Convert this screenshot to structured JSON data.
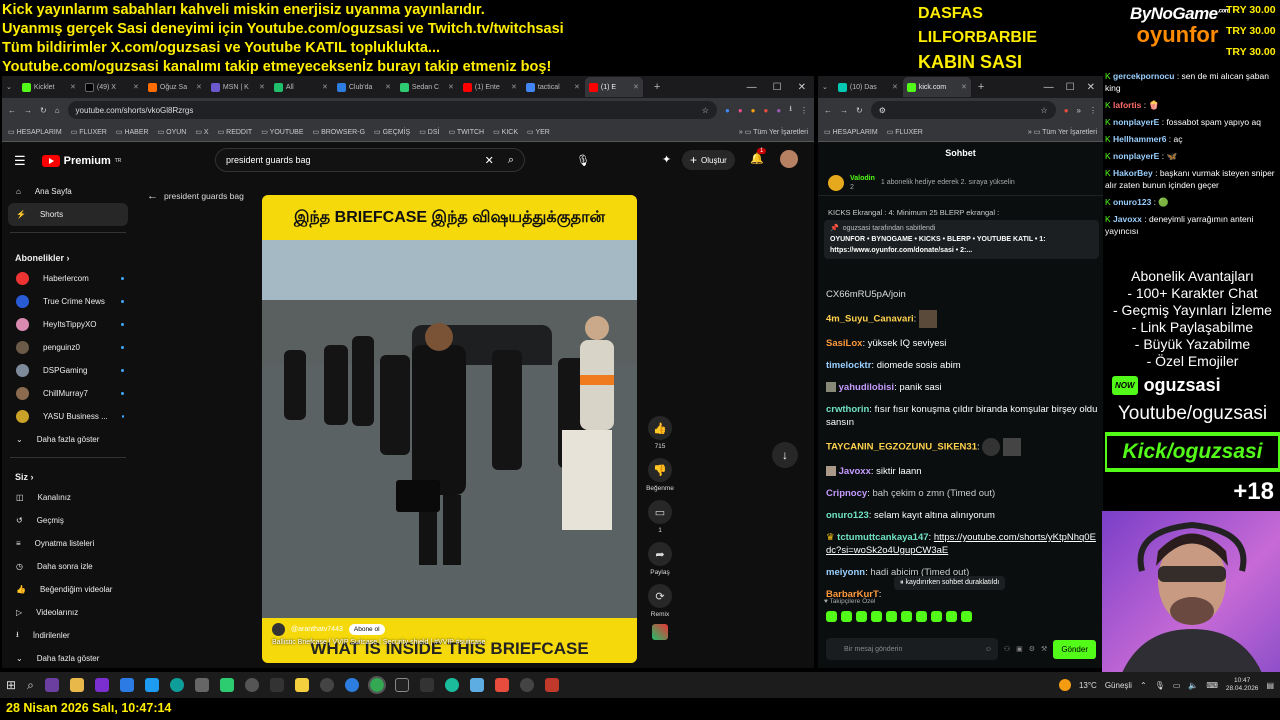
{
  "overlay": {
    "lines": [
      "Kick yayınlarım sabahları kahveli miskin enerjisiz uyanma yayınlarıdır.",
      "Uyanmış gerçek Sasi deneyimi için Youtube.com/oguzsasi ve Twitch.tv/twitchsasi",
      "Tüm bildirimler X.com/oguzsasi ve Youtube KATIL topluklukta...",
      "Youtube.com/oguzsasi kanalımı takip etmeyeceksenİz burayı takip etmeniz boş!"
    ],
    "names": [
      "DASFAS",
      "LILFORBARBIE",
      "KABIN SASI"
    ],
    "logo_top": "ByNoGame",
    "logo_com": ".com",
    "logo_bottom": "oyunfor",
    "try": [
      "TRY 30.00",
      "TRY 30.00",
      "TRY 30.00"
    ],
    "date_line": "28 Nisan 2026 Salı, 10:47:14"
  },
  "browser1": {
    "tabs": [
      "Kicklet",
      "(49) X",
      "Oğuz Sa",
      "MSN | K",
      "All",
      "Club'da",
      "Sedan C",
      "(1) Ente",
      "tactical",
      "(1) E"
    ],
    "url": "youtube.com/shorts/vkoGl8Rzrgs",
    "bookmarks": [
      "HESAPLARIM",
      "FLUXER",
      "HABER",
      "OYUN",
      "X",
      "REDDIT",
      "YOUTUBE",
      "BROWSER-G",
      "GEÇMİŞ",
      "DSİ",
      "TWITCH",
      "KICK",
      "YER"
    ],
    "bookmarks_all": "Tüm Yer İşaretleri"
  },
  "youtube": {
    "logo": "Premium",
    "logo_sup": "TR",
    "search_value": "president guards bag",
    "create": "Oluştur",
    "notif_count": "1",
    "nav": [
      "Ana Sayfa",
      "Shorts"
    ],
    "subs_title": "Abonelikler",
    "subs": [
      "Haberlercom",
      "True Crime News",
      "HeyItsTippyXO",
      "penguinz0",
      "DSPGaming",
      "ChillMurray7",
      "YASU Business ..."
    ],
    "more_subs": "Daha fazla göster",
    "you_title": "Siz",
    "you_items": [
      "Kanalınız",
      "Geçmiş",
      "Oynatma listeleri",
      "Daha sonra izle",
      "Beğendiğim videolar",
      "Videolarınız",
      "İndirilenler",
      "Daha fazla göster"
    ],
    "short_back": "president guards bag",
    "video_top": "இந்த BRIEFCASE இந்த விஷயத்துக்குதான்",
    "video_bottom": "WHAT IS INSIDE THIS BRIEFCASE",
    "channel": "@aranthatv7443",
    "subscribe": "Abone ol",
    "caption": "Ballistic Briefcase | VVIP Suitcase | Security shield | #VVIP #suitcase",
    "likes": "715",
    "dislike_label": "Beğenme",
    "comments": "1",
    "share_label": "Paylaş",
    "remix_label": "Remix"
  },
  "browser2": {
    "tabs": [
      "(10) Das",
      "kick.com"
    ],
    "bookmarks": [
      "HESAPLARIM",
      "FLUXER"
    ],
    "bookmarks_all": "Tüm Yer İşaretleri"
  },
  "kickchat": {
    "title": "Sohbet",
    "gift_user": "Valodin",
    "gift_count": "2",
    "gift_text": "1 abonelik hediye ederek 2. sıraya yükselin",
    "ticker": "KICKS Ekrangal : 4: Minimum 25 BLERP ekrangal :",
    "pinned_by": "oguzsasi tarafından sabitlendi",
    "pinned_text": "OYUNFOR • BYNOGAME • KICKS • BLERP • YOUTUBE KATIL • 1: https://www.oyunfor.com/donate/sasi • 2:...",
    "link_tail": "CX66mRU5pA/join",
    "messages": [
      {
        "user": "4m_Suyu_Canavari",
        "text": "",
        "color": "#ffd24d"
      },
      {
        "user": "SasiLox",
        "text": "yüksek IQ seviyesi",
        "color": "#ff9a3c"
      },
      {
        "user": "timelocktr",
        "text": "diomede sosis abim",
        "color": "#9ad0ff"
      },
      {
        "user": "yahudilobisi",
        "text": "panik sasi",
        "color": "#c59bff"
      },
      {
        "user": "crwthorin",
        "text": "fısır fısır konuşma çıldır biranda komşular birşey oldu sansın",
        "color": "#6fe3c4"
      },
      {
        "user": "TAYCANIN_EGZOZUNU_SIKEN31",
        "text": "",
        "color": "#ffd24d"
      },
      {
        "user": "Javoxx",
        "text": "siktir laann",
        "color": "#c59bff"
      },
      {
        "user": "Cripnocy",
        "text": "bah çekim o zmn (Timed out)",
        "color": "#c59bff"
      },
      {
        "user": "onuro123",
        "text": "selam kayıt altına alınıyorum",
        "color": "#6fe3c4"
      },
      {
        "user": "tctumuttcankaya147",
        "text": "https://youtube.com/shorts/yKtpNhq0Edc?si=woSk2o4UgupCW3aE",
        "color": "#6fe3c4"
      },
      {
        "user": "meiyonn",
        "text": "hadi abicim (Timed out)",
        "color": "#9ad0ff"
      },
      {
        "user": "BarbarKurT",
        "text": "",
        "color": "#ff9a3c"
      }
    ],
    "paused": "kaydırırken sohbet duraklatıldı",
    "emote_tab": "Takipçilere Özel",
    "input_placeholder": "Bir mesaj gönderin",
    "send": "Gönder"
  },
  "right_chat": [
    {
      "user": "gercekpornocu",
      "text": "sen de mi alıcan şaban king"
    },
    {
      "user": "lafortis",
      "text": "🍿"
    },
    {
      "user": "nonplayerE",
      "text": "fossabot spam yapıyo aq"
    },
    {
      "user": "Hellhammer6",
      "text": "aç"
    },
    {
      "user": "nonplayerE",
      "text": "🦋"
    },
    {
      "user": "HakorBey",
      "text": "başkanı vurmak isteyen sniper alır zaten bunun içinden geçer"
    },
    {
      "user": "onuro123",
      "text": "🟢"
    },
    {
      "user": "Javoxx",
      "text": "deneyimli yarrağımın anteni yayıncısı"
    }
  ],
  "perks": [
    "Abonelik Avantajları",
    "- 100+ Karakter Chat",
    "- Geçmiş Yayınları İzleme",
    "- Link Paylaşabilme",
    "- Büyük Yazabilme",
    "- Özel Emojiler"
  ],
  "now_badge": "NOW",
  "now_user": "oguzsasi",
  "yt_handle": "Youtube/oguzsasi",
  "kick_handle": "Kick/oguzsasi",
  "age": "+18",
  "taskbar": {
    "weather": "13°C",
    "weather_label": "Güneşli",
    "time": "10:47",
    "date": "28.04.2026"
  }
}
